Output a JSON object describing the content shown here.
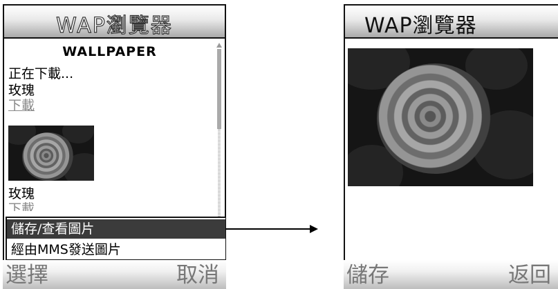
{
  "left_screen": {
    "title": "WAP瀏覽器",
    "page_heading": "WALLPAPER",
    "status_text": "正在下載...",
    "item1_name": "玫瑰",
    "item1_link": "下載",
    "item2_name": "玫瑰",
    "item2_link": "下載",
    "menu": {
      "items": [
        "儲存/查看圖片",
        "經由MMS發送圖片"
      ],
      "selected_index": 0
    },
    "softkey_left": "選擇",
    "softkey_right": "取消"
  },
  "right_screen": {
    "title": "WAP瀏覽器",
    "softkey_left": "儲存",
    "softkey_right": "返回"
  },
  "colors": {
    "menu_highlight": "#3b3b3b",
    "link": "#888888"
  },
  "icons": {
    "scroll_up": "scroll-up-arrow-icon",
    "flow_arrow": "right-arrow-icon"
  }
}
